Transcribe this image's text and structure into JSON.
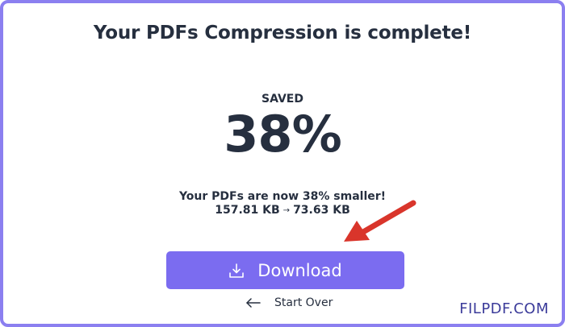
{
  "header": {
    "title": "Your PDFs Compression is complete!"
  },
  "result": {
    "saved_label": "SAVED",
    "saved_percent": "38%",
    "summary": "Your PDFs are now 38% smaller!",
    "original_size": "157.81 KB",
    "arrow": "→",
    "compressed_size": "73.63 KB"
  },
  "actions": {
    "download_label": "Download",
    "start_over_label": "Start Over"
  },
  "watermark": {
    "text": "FILPDF.COM"
  },
  "icons": {
    "download": "download-icon",
    "back": "arrow-left-icon",
    "annotation": "red-pointer-arrow"
  },
  "colors": {
    "accent": "#7b6cf0",
    "border": "#8b7ff0",
    "text": "#262f3f",
    "annotation": "#d9352b",
    "watermark": "#3b3b9a"
  }
}
